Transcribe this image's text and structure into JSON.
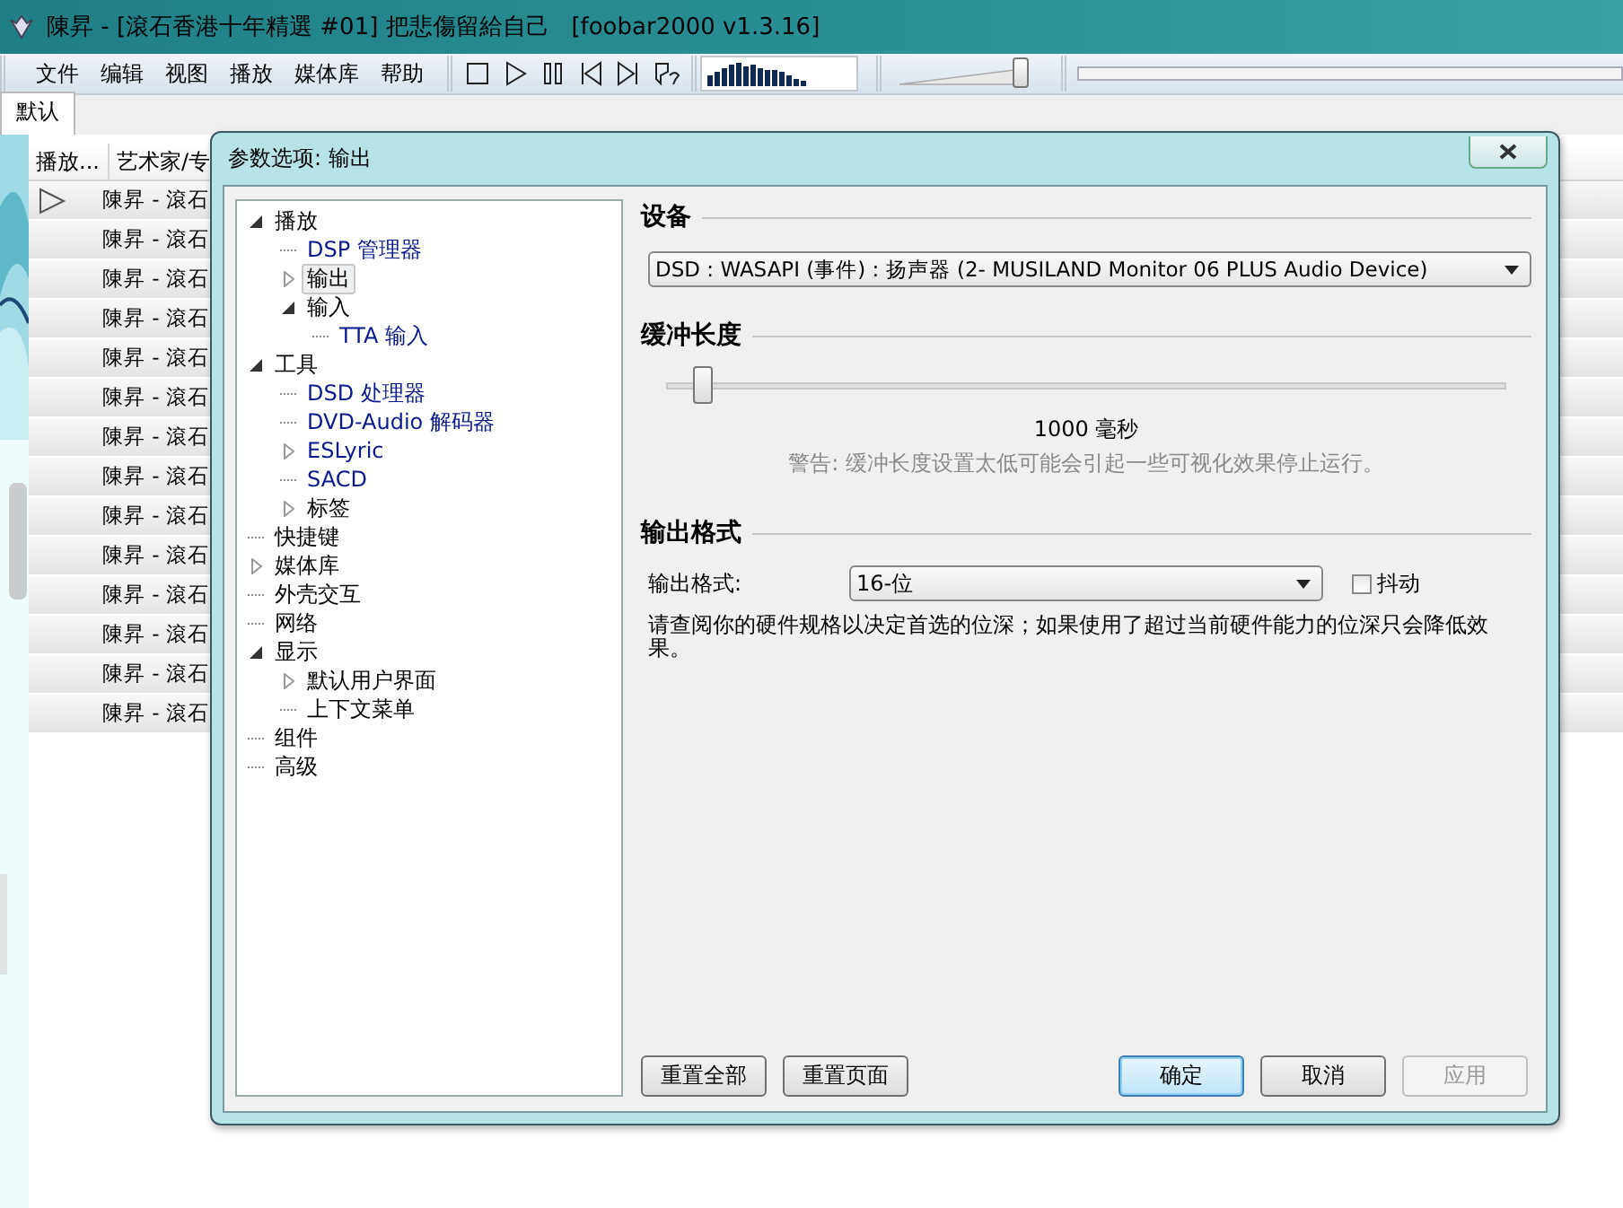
{
  "window": {
    "title": "陳昇 - [滾石香港十年精選 #01] 把悲傷留給自己   [foobar2000 v1.3.16]"
  },
  "menu": [
    "文件",
    "编辑",
    "视图",
    "播放",
    "媒体库",
    "帮助"
  ],
  "volume": {
    "level": 0.93
  },
  "tabs": [
    {
      "label": "默认",
      "selected": true
    }
  ],
  "playlist": {
    "columns": [
      "播放...",
      "艺术家/专"
    ],
    "rows": [
      {
        "playing": true,
        "title": "陳昇 - 滾石"
      },
      {
        "playing": false,
        "title": "陳昇 - 滾石"
      },
      {
        "playing": false,
        "title": "陳昇 - 滾石"
      },
      {
        "playing": false,
        "title": "陳昇 - 滾石"
      },
      {
        "playing": false,
        "title": "陳昇 - 滾石"
      },
      {
        "playing": false,
        "title": "陳昇 - 滾石"
      },
      {
        "playing": false,
        "title": "陳昇 - 滾石"
      },
      {
        "playing": false,
        "title": "陳昇 - 滾石"
      },
      {
        "playing": false,
        "title": "陳昇 - 滾石"
      },
      {
        "playing": false,
        "title": "陳昇 - 滾石"
      },
      {
        "playing": false,
        "title": "陳昇 - 滾石"
      },
      {
        "playing": false,
        "title": "陳昇 - 滾石"
      },
      {
        "playing": false,
        "title": "陳昇 - 滾石"
      },
      {
        "playing": false,
        "title": "陳昇 - 滾石"
      }
    ]
  },
  "dialog": {
    "title": "参数选项: 输出",
    "tree": [
      {
        "label": "播放",
        "kind": "group",
        "expanded": true,
        "selected": false,
        "color": "#000000",
        "children": [
          {
            "label": "DSP 管理器",
            "kind": "leaf",
            "selected": false,
            "color": "#0a1a8c"
          },
          {
            "label": "输出",
            "kind": "group",
            "expanded": false,
            "selected": true,
            "color": "#000000"
          },
          {
            "label": "输入",
            "kind": "group",
            "expanded": true,
            "selected": false,
            "color": "#000000",
            "children": [
              {
                "label": "TTA 输入",
                "kind": "leaf",
                "selected": false,
                "color": "#0a1a8c"
              }
            ]
          }
        ]
      },
      {
        "label": "工具",
        "kind": "group",
        "expanded": true,
        "selected": false,
        "color": "#000000",
        "children": [
          {
            "label": "DSD 处理器",
            "kind": "leaf",
            "selected": false,
            "color": "#0a1a8c"
          },
          {
            "label": "DVD-Audio 解码器",
            "kind": "leaf",
            "selected": false,
            "color": "#0a1a8c"
          },
          {
            "label": "ESLyric",
            "kind": "group",
            "expanded": false,
            "selected": false,
            "color": "#0a1a8c"
          },
          {
            "label": "SACD",
            "kind": "leaf",
            "selected": false,
            "color": "#0a1a8c"
          },
          {
            "label": "标签",
            "kind": "group",
            "expanded": false,
            "selected": false,
            "color": "#000000"
          }
        ]
      },
      {
        "label": "快捷键",
        "kind": "leaf",
        "selected": false,
        "color": "#000000"
      },
      {
        "label": "媒体库",
        "kind": "group",
        "expanded": false,
        "selected": false,
        "color": "#000000"
      },
      {
        "label": "外壳交互",
        "kind": "leaf",
        "selected": false,
        "color": "#000000"
      },
      {
        "label": "网络",
        "kind": "leaf",
        "selected": false,
        "color": "#000000"
      },
      {
        "label": "显示",
        "kind": "group",
        "expanded": true,
        "selected": false,
        "color": "#000000",
        "children": [
          {
            "label": "默认用户界面",
            "kind": "group",
            "expanded": false,
            "selected": false,
            "color": "#000000"
          },
          {
            "label": "上下文菜单",
            "kind": "leaf",
            "selected": false,
            "color": "#000000"
          }
        ]
      },
      {
        "label": "组件",
        "kind": "leaf",
        "selected": false,
        "color": "#000000"
      },
      {
        "label": "高级",
        "kind": "leaf",
        "selected": false,
        "color": "#000000"
      }
    ],
    "device": {
      "heading": "设备",
      "value": "DSD : WASAPI (事件) : 扬声器 (2- MUSILAND Monitor 06 PLUS Audio Device)"
    },
    "buffer": {
      "heading": "缓冲长度",
      "level": 0.04,
      "reading": "1000 毫秒",
      "warning": "警告: 缓冲长度设置太低可能会引起一些可视化效果停止运行。"
    },
    "output_format": {
      "heading": "输出格式",
      "label": "输出格式:",
      "value": "16-位",
      "dither": {
        "label": "抖动",
        "checked": false
      },
      "note": "请查阅你的硬件规格以决定首选的位深；如果使用了超过当前硬件能力的位深只会降低效果。"
    },
    "reset_buttons": [
      {
        "label": "重置全部",
        "default": false,
        "disabled": false
      },
      {
        "label": "重置页面",
        "default": false,
        "disabled": false
      }
    ],
    "buttons": [
      {
        "label": "确定",
        "default": true,
        "disabled": false
      },
      {
        "label": "取消",
        "default": false,
        "disabled": false
      },
      {
        "label": "应用",
        "default": false,
        "disabled": true
      }
    ]
  }
}
